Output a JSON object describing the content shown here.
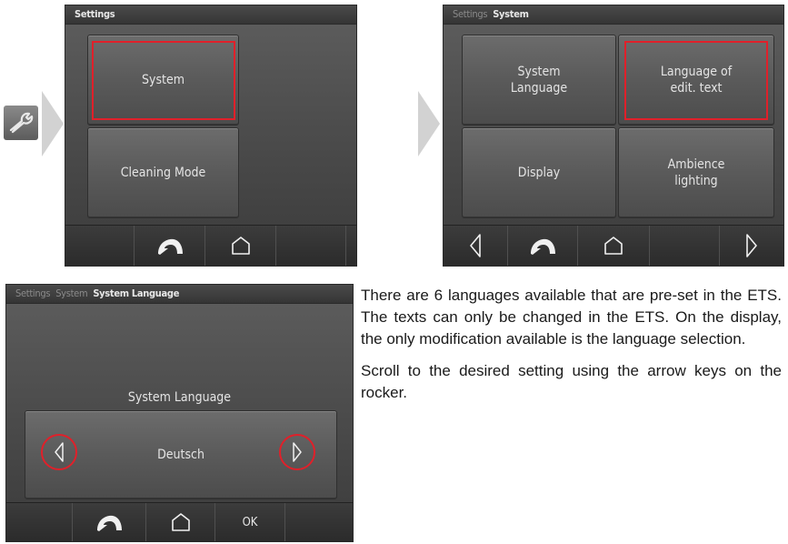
{
  "screen1": {
    "title": "Settings",
    "tiles": [
      "System",
      "Cleaning Mode"
    ]
  },
  "screen2": {
    "breadcrumb_parent": "Settings",
    "title": "System",
    "tiles": [
      "System\nLanguage",
      "Language of\nedit. text",
      "Display",
      "Ambience\nlighting"
    ]
  },
  "screen3": {
    "breadcrumb_1": "Settings",
    "breadcrumb_2": "System",
    "title": "System Language",
    "setting_label": "System Language",
    "setting_value": "Deutsch",
    "ok_label": "OK"
  },
  "icons": {
    "settings_entry": "wrench-icon",
    "back": "back-arrow-icon",
    "home": "home-icon",
    "prev": "left-arrow-icon",
    "next": "right-arrow-icon"
  },
  "colors": {
    "highlight": "#e0202a",
    "chevron": "#d0d0d0"
  },
  "description": {
    "p1": "There are 6 languages available that are pre-set in the ETS. The texts can only be changed in the ETS. On the display, the only modification available is the language selection.",
    "p2": "Scroll to the desired setting using the arrow keys on the rocker."
  }
}
